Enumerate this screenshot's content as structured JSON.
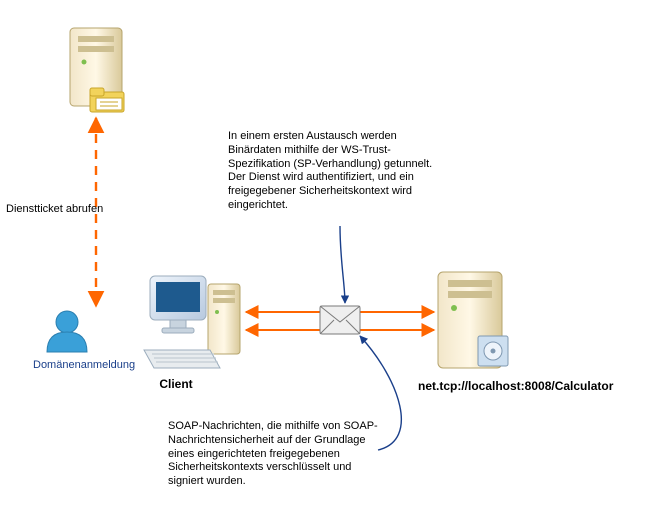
{
  "nodes": {
    "domain_controller": {
      "label": ""
    },
    "user": {
      "label": "Domänenanmeldung"
    },
    "client": {
      "label": "Client"
    },
    "service": {
      "label": "net.tcp://localhost:8008/Calculator"
    }
  },
  "edges": {
    "ticket_request": {
      "label": "Dienstticket abrufen"
    }
  },
  "annotations": {
    "initial_exchange": "In einem ersten Austausch werden Binärdaten mithilfe der WS-Trust-Spezifikation (SP-Verhandlung) getunnelt. Der Dienst wird authentifiziert, und ein freigegebener Sicherheitskontext wird eingerichtet.",
    "soap_messages": "SOAP-Nachrichten, die mithilfe von SOAP-Nachrichtensicherheit auf der Grundlage eines eingerichteten freigegebenen Sicherheitskontexts verschlüsselt und signiert wurden."
  }
}
